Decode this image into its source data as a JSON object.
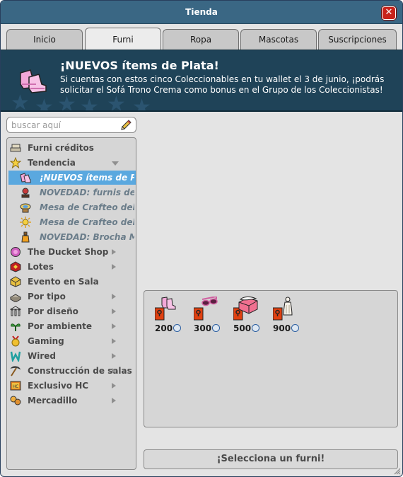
{
  "window": {
    "title": "Tienda",
    "close_label": "✕"
  },
  "tabs": [
    {
      "label": "Inicio",
      "active": false
    },
    {
      "label": "Furni",
      "active": true
    },
    {
      "label": "Ropa",
      "active": false
    },
    {
      "label": "Mascotas",
      "active": false
    },
    {
      "label": "Suscripciones",
      "active": false
    }
  ],
  "banner": {
    "title": "¡NUEVOS ítems de Plata!",
    "text": "Si cuentas con estos cinco Coleccionables en tu wallet el 3 de junio, ¡podrás solicitar el Sofá Trono Crema como bonus en el Grupo de los Coleccionistas!",
    "icon": "pink-slippers-icon"
  },
  "search": {
    "placeholder": "buscar aquí",
    "value": ""
  },
  "catalog": {
    "items": [
      {
        "label": "Furni créditos",
        "icon": "furni-stack-icon",
        "arrow": "none",
        "level": 0
      },
      {
        "label": "Tendencia",
        "icon": "star-icon",
        "arrow": "down",
        "level": 0
      },
      {
        "label": "¡NUEVOS ítems de Plata",
        "icon": "pink-slippers-icon",
        "arrow": "none",
        "level": 1,
        "selected": true
      },
      {
        "label": "NOVEDAD: furnis del Po",
        "icon": "rose-icon",
        "arrow": "none",
        "level": 1
      },
      {
        "label": "Mesa de Crafteo del Som",
        "icon": "craft-table-icon",
        "arrow": "none",
        "level": 1
      },
      {
        "label": "Mesa de Crafteo del Som",
        "icon": "sun-icon",
        "arrow": "none",
        "level": 1
      },
      {
        "label": "NOVEDAD: Brocha Man",
        "icon": "paint-bottle-icon",
        "arrow": "none",
        "level": 1
      },
      {
        "label": "The Ducket Shop",
        "icon": "ducket-icon",
        "arrow": "right",
        "level": 0
      },
      {
        "label": "Lotes",
        "icon": "bundle-icon",
        "arrow": "right",
        "level": 0
      },
      {
        "label": "Evento en Sala",
        "icon": "event-icon",
        "arrow": "none",
        "level": 0
      },
      {
        "label": "Por tipo",
        "icon": "type-icon",
        "arrow": "right",
        "level": 0
      },
      {
        "label": "Por diseño",
        "icon": "columns-icon",
        "arrow": "right",
        "level": 0
      },
      {
        "label": "Por ambiente",
        "icon": "plant-icon",
        "arrow": "right",
        "level": 0
      },
      {
        "label": "Gaming",
        "icon": "medal-icon",
        "arrow": "right",
        "level": 0
      },
      {
        "label": "Wired",
        "icon": "wired-icon",
        "arrow": "right",
        "level": 0
      },
      {
        "label": "Construcción de salas",
        "icon": "pickaxe-icon",
        "arrow": "right",
        "level": 0
      },
      {
        "label": "Exclusivo HC",
        "icon": "hc-icon",
        "arrow": "right",
        "level": 0
      },
      {
        "label": "Mercadillo",
        "icon": "market-icon",
        "arrow": "right",
        "level": 0
      }
    ]
  },
  "products": [
    {
      "price": "200",
      "icon": "pink-slippers-icon"
    },
    {
      "price": "300",
      "icon": "pink-sunglasses-icon"
    },
    {
      "price": "500",
      "icon": "pink-cake-icon"
    },
    {
      "price": "900",
      "icon": "white-statue-icon"
    }
  ],
  "actions": {
    "select_label": "¡Selecciona un furni!"
  },
  "colors": {
    "titlebar": "#3a6784",
    "banner": "#1f4358",
    "selected": "#5aa8df",
    "close": "#c8231b"
  }
}
